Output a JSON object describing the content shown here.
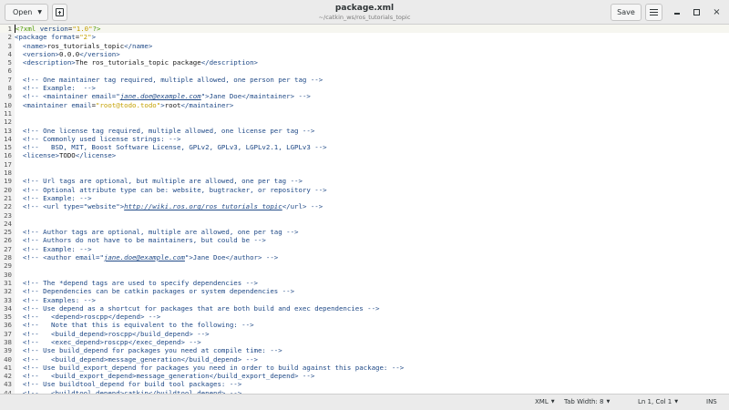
{
  "header": {
    "open_label": "Open",
    "title": "package.xml",
    "subtitle": "~/catkin_ws/ros_tutorials_topic",
    "save_label": "Save",
    "close_glyph": "×"
  },
  "icons": {
    "open_caret": "chevron-down-icon",
    "new_tab": "new-tab-icon",
    "menu": "hamburger-menu-icon",
    "minimize": "minimize-icon",
    "maximize": "maximize-icon",
    "close": "close-icon"
  },
  "colors": {
    "tag": "#204a87",
    "string": "#c4a000",
    "text": "#1a1a1a",
    "gutter": "#f2f2f2",
    "headerbar": "#ebebeb"
  },
  "editor": {
    "lines": [
      {
        "n": "1",
        "segs": [
          [
            "pi",
            "<?xml "
          ],
          [
            "attr",
            "version"
          ],
          [
            "plain",
            "="
          ],
          [
            "str",
            "\"1.0\""
          ],
          [
            "pi",
            "?>"
          ]
        ]
      },
      {
        "n": "2",
        "segs": [
          [
            "tag",
            "<package "
          ],
          [
            "attr",
            "format"
          ],
          [
            "plain",
            "="
          ],
          [
            "str",
            "\"2\""
          ],
          [
            "tag",
            ">"
          ]
        ]
      },
      {
        "n": "3",
        "segs": [
          [
            "plain",
            "  "
          ],
          [
            "tag",
            "<name>"
          ],
          [
            "plain",
            "ros_tutorials_topic"
          ],
          [
            "tag",
            "</name>"
          ]
        ]
      },
      {
        "n": "4",
        "segs": [
          [
            "plain",
            "  "
          ],
          [
            "tag",
            "<version>"
          ],
          [
            "plain",
            "0.0.0"
          ],
          [
            "tag",
            "</version>"
          ]
        ]
      },
      {
        "n": "5",
        "segs": [
          [
            "plain",
            "  "
          ],
          [
            "tag",
            "<description>"
          ],
          [
            "plain",
            "The ros_tutorials_topic package"
          ],
          [
            "tag",
            "</description>"
          ]
        ]
      },
      {
        "n": "6",
        "segs": []
      },
      {
        "n": "7",
        "segs": [
          [
            "plain",
            "  "
          ],
          [
            "comment",
            "<!-- One maintainer tag required, multiple allowed, one person per tag -->"
          ]
        ]
      },
      {
        "n": "8",
        "segs": [
          [
            "plain",
            "  "
          ],
          [
            "comment",
            "<!-- Example:  -->"
          ]
        ]
      },
      {
        "n": "9",
        "segs": [
          [
            "plain",
            "  "
          ],
          [
            "comment",
            "<!-- <maintainer email=\""
          ],
          [
            "url",
            "jane.doe@example.com"
          ],
          [
            "comment",
            "\">Jane Doe</maintainer> -->"
          ]
        ]
      },
      {
        "n": "10",
        "segs": [
          [
            "plain",
            "  "
          ],
          [
            "tag",
            "<maintainer "
          ],
          [
            "attr",
            "email"
          ],
          [
            "plain",
            "="
          ],
          [
            "str",
            "\"root@todo.todo\""
          ],
          [
            "tag",
            ">"
          ],
          [
            "plain",
            "root"
          ],
          [
            "tag",
            "</maintainer>"
          ]
        ]
      },
      {
        "n": "11",
        "segs": []
      },
      {
        "n": "12",
        "segs": []
      },
      {
        "n": "13",
        "segs": [
          [
            "plain",
            "  "
          ],
          [
            "comment",
            "<!-- One license tag required, multiple allowed, one license per tag -->"
          ]
        ]
      },
      {
        "n": "14",
        "segs": [
          [
            "plain",
            "  "
          ],
          [
            "comment",
            "<!-- Commonly used license strings: -->"
          ]
        ]
      },
      {
        "n": "15",
        "segs": [
          [
            "plain",
            "  "
          ],
          [
            "comment",
            "<!--   BSD, MIT, Boost Software License, GPLv2, GPLv3, LGPLv2.1, LGPLv3 -->"
          ]
        ]
      },
      {
        "n": "16",
        "segs": [
          [
            "plain",
            "  "
          ],
          [
            "tag",
            "<license>"
          ],
          [
            "plain",
            "TODO"
          ],
          [
            "tag",
            "</license>"
          ]
        ]
      },
      {
        "n": "17",
        "segs": []
      },
      {
        "n": "18",
        "segs": []
      },
      {
        "n": "19",
        "segs": [
          [
            "plain",
            "  "
          ],
          [
            "comment",
            "<!-- Url tags are optional, but multiple are allowed, one per tag -->"
          ]
        ]
      },
      {
        "n": "20",
        "segs": [
          [
            "plain",
            "  "
          ],
          [
            "comment",
            "<!-- Optional attribute type can be: website, bugtracker, or repository -->"
          ]
        ]
      },
      {
        "n": "21",
        "segs": [
          [
            "plain",
            "  "
          ],
          [
            "comment",
            "<!-- Example: -->"
          ]
        ]
      },
      {
        "n": "22",
        "segs": [
          [
            "plain",
            "  "
          ],
          [
            "comment",
            "<!-- <url type=\"website\">"
          ],
          [
            "url",
            "http://wiki.ros.org/ros_tutorials_topic"
          ],
          [
            "comment",
            "</url> -->"
          ]
        ]
      },
      {
        "n": "23",
        "segs": []
      },
      {
        "n": "24",
        "segs": []
      },
      {
        "n": "25",
        "segs": [
          [
            "plain",
            "  "
          ],
          [
            "comment",
            "<!-- Author tags are optional, multiple are allowed, one per tag -->"
          ]
        ]
      },
      {
        "n": "26",
        "segs": [
          [
            "plain",
            "  "
          ],
          [
            "comment",
            "<!-- Authors do not have to be maintainers, but could be -->"
          ]
        ]
      },
      {
        "n": "27",
        "segs": [
          [
            "plain",
            "  "
          ],
          [
            "comment",
            "<!-- Example: -->"
          ]
        ]
      },
      {
        "n": "28",
        "segs": [
          [
            "plain",
            "  "
          ],
          [
            "comment",
            "<!-- <author email=\""
          ],
          [
            "url",
            "jane.doe@example.com"
          ],
          [
            "comment",
            "\">Jane Doe</author> -->"
          ]
        ]
      },
      {
        "n": "29",
        "segs": []
      },
      {
        "n": "30",
        "segs": []
      },
      {
        "n": "31",
        "segs": [
          [
            "plain",
            "  "
          ],
          [
            "comment",
            "<!-- The *depend tags are used to specify dependencies -->"
          ]
        ]
      },
      {
        "n": "32",
        "segs": [
          [
            "plain",
            "  "
          ],
          [
            "comment",
            "<!-- Dependencies can be catkin packages or system dependencies -->"
          ]
        ]
      },
      {
        "n": "33",
        "segs": [
          [
            "plain",
            "  "
          ],
          [
            "comment",
            "<!-- Examples: -->"
          ]
        ]
      },
      {
        "n": "34",
        "segs": [
          [
            "plain",
            "  "
          ],
          [
            "comment",
            "<!-- Use depend as a shortcut for packages that are both build and exec dependencies -->"
          ]
        ]
      },
      {
        "n": "35",
        "segs": [
          [
            "plain",
            "  "
          ],
          [
            "comment",
            "<!--   <depend>roscpp</depend> -->"
          ]
        ]
      },
      {
        "n": "36",
        "segs": [
          [
            "plain",
            "  "
          ],
          [
            "comment",
            "<!--   Note that this is equivalent to the following: -->"
          ]
        ]
      },
      {
        "n": "37",
        "segs": [
          [
            "plain",
            "  "
          ],
          [
            "comment",
            "<!--   <build_depend>roscpp</build_depend> -->"
          ]
        ]
      },
      {
        "n": "38",
        "segs": [
          [
            "plain",
            "  "
          ],
          [
            "comment",
            "<!--   <exec_depend>roscpp</exec_depend> -->"
          ]
        ]
      },
      {
        "n": "39",
        "segs": [
          [
            "plain",
            "  "
          ],
          [
            "comment",
            "<!-- Use build_depend for packages you need at compile time: -->"
          ]
        ]
      },
      {
        "n": "40",
        "segs": [
          [
            "plain",
            "  "
          ],
          [
            "comment",
            "<!--   <build_depend>message_generation</build_depend> -->"
          ]
        ]
      },
      {
        "n": "41",
        "segs": [
          [
            "plain",
            "  "
          ],
          [
            "comment",
            "<!-- Use build_export_depend for packages you need in order to build against this package: -->"
          ]
        ]
      },
      {
        "n": "42",
        "segs": [
          [
            "plain",
            "  "
          ],
          [
            "comment",
            "<!--   <build_export_depend>message_generation</build_export_depend> -->"
          ]
        ]
      },
      {
        "n": "43",
        "segs": [
          [
            "plain",
            "  "
          ],
          [
            "comment",
            "<!-- Use buildtool_depend for build tool packages: -->"
          ]
        ]
      },
      {
        "n": "44",
        "segs": [
          [
            "plain",
            "  "
          ],
          [
            "comment",
            "<!--   <buildtool_depend>catkin</buildtool_depend> -->"
          ]
        ]
      }
    ]
  },
  "statusbar": {
    "language": "XML",
    "tab_width": "Tab Width: 8",
    "position": "Ln 1, Col 1",
    "mode": "INS"
  }
}
